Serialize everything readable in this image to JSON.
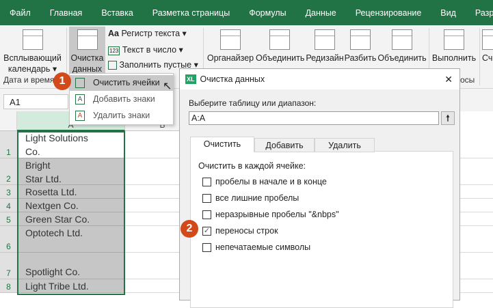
{
  "menu": [
    "Файл",
    "Главная",
    "Вставка",
    "Разметка страницы",
    "Формулы",
    "Данные",
    "Рецензирование",
    "Вид",
    "Разработч"
  ],
  "ribbon": {
    "popup_calendar": [
      "Всплывающий",
      "календарь ▾"
    ],
    "clean_data": [
      "Очистка",
      "данных ▾"
    ],
    "case": "Регистр текста ▾",
    "text_to_num": "Текст в число ▾",
    "fill_blank": "Заполнить пустые ▾",
    "organizer": "Органайзер",
    "merge1": "Объединить",
    "redesign": "Редизайн",
    "split": "Разбить",
    "merge2": "Объединить",
    "run": "Выполнить",
    "more": "Сч",
    "group_date": "Дата и время",
    "group_queries": "осы"
  },
  "namebox": "A1",
  "dropdown": {
    "items": [
      "Очистить ячейки",
      "Добавить знаки",
      "Удалить знаки"
    ]
  },
  "badges": [
    "1",
    "2"
  ],
  "grid": {
    "cols": [
      "A",
      "B"
    ],
    "rows": [
      {
        "n": "1",
        "lines": [
          "Light Solutions",
          "Co."
        ]
      },
      {
        "n": "2",
        "lines": [
          "Bright",
          "Star Ltd."
        ]
      },
      {
        "n": "3",
        "lines": [
          "Rosetta Ltd."
        ]
      },
      {
        "n": "4",
        "lines": [
          "Nextgen Co."
        ]
      },
      {
        "n": "5",
        "lines": [
          "Green Star Co."
        ]
      },
      {
        "n": "6",
        "lines": [
          "Optotech Ltd."
        ]
      },
      {
        "n": "7",
        "lines": [
          "Spotlight Co."
        ]
      },
      {
        "n": "8",
        "lines": [
          "Light Tribe Ltd."
        ]
      }
    ]
  },
  "dialog": {
    "logo": "XL",
    "title": "Очистка данных",
    "close": "✕",
    "range_label": "Выберите таблицу или диапазон:",
    "range_value": "A:A",
    "range_btn": "🠕",
    "tabs": [
      "Очистить",
      "Добавить",
      "Удалить"
    ],
    "section": "Очистить в каждой ячейке:",
    "options": [
      {
        "label": "пробелы в начале и в конце",
        "checked": false
      },
      {
        "label": "все лишние пробелы",
        "checked": false
      },
      {
        "label": "неразрывные пробелы \"&nbps\"",
        "checked": false
      },
      {
        "label": "переносы строк",
        "checked": true
      },
      {
        "label": "непечатаемые символы",
        "checked": false
      }
    ]
  }
}
